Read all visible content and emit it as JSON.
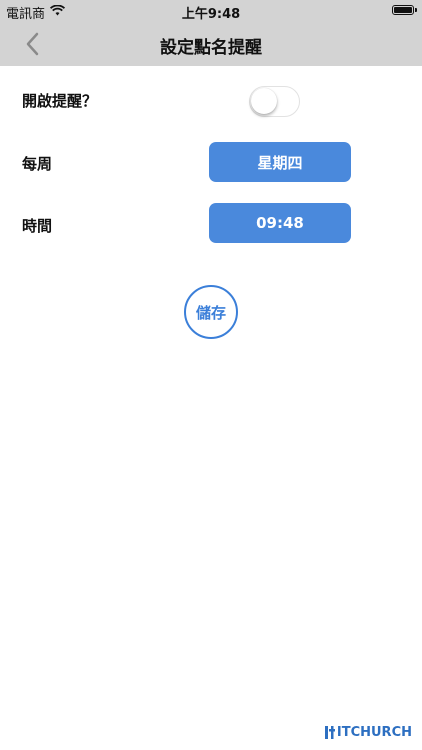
{
  "status_bar": {
    "carrier": "電訊商",
    "time": "上午9:48",
    "wifi_icon": "wifi-icon",
    "battery_icon": "battery-icon"
  },
  "nav": {
    "title": "設定點名提醒",
    "back_icon": "chevron-left-icon"
  },
  "settings": {
    "reminder_label": "開啟提醒？",
    "reminder_enabled": false,
    "weekday_label": "每周",
    "weekday_value": "星期四",
    "time_label": "時間",
    "time_value": "09:48"
  },
  "actions": {
    "save_label": "儲存"
  },
  "colors": {
    "accent": "#4a89dc",
    "save_outline": "#3b7fd9",
    "bar_background": "#d3d3d3"
  },
  "logo": "ITCHURCH"
}
